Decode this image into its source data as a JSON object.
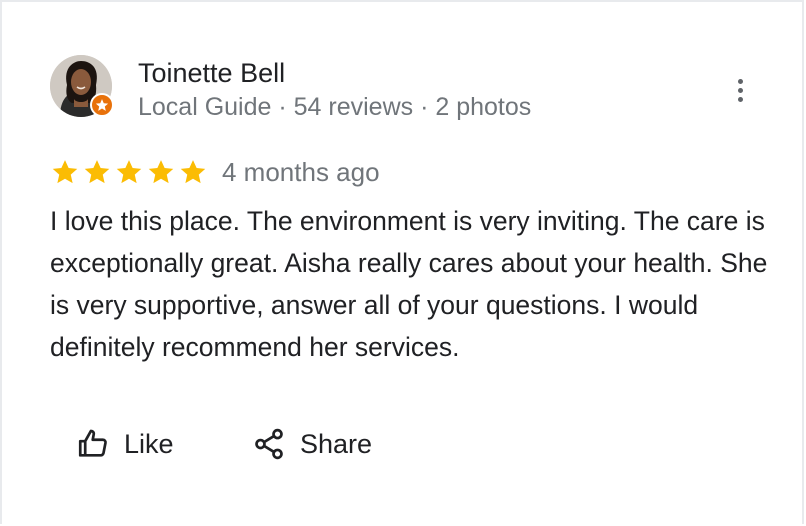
{
  "review": {
    "author": "Toinette Bell",
    "meta": "Local Guide · 54 reviews · 2 photos",
    "rating": 5,
    "age": "4 months ago",
    "text": "I love this place. The environment is very inviting. The care is exceptionally great. Aisha really cares about your health. She is very supportive, answer all of your questions. I would definitely recommend her services.",
    "icons": {
      "avatar": "profile-photo",
      "badge": "local-guide-star-icon",
      "menu": "more-vert-icon",
      "star": "star-icon",
      "like": "thumb-up-icon",
      "share": "share-icon"
    },
    "colors": {
      "star": "#fbbc04",
      "badge": "#e8710a",
      "secondary_text": "#70757a"
    }
  },
  "actions": {
    "like_label": "Like",
    "share_label": "Share"
  }
}
